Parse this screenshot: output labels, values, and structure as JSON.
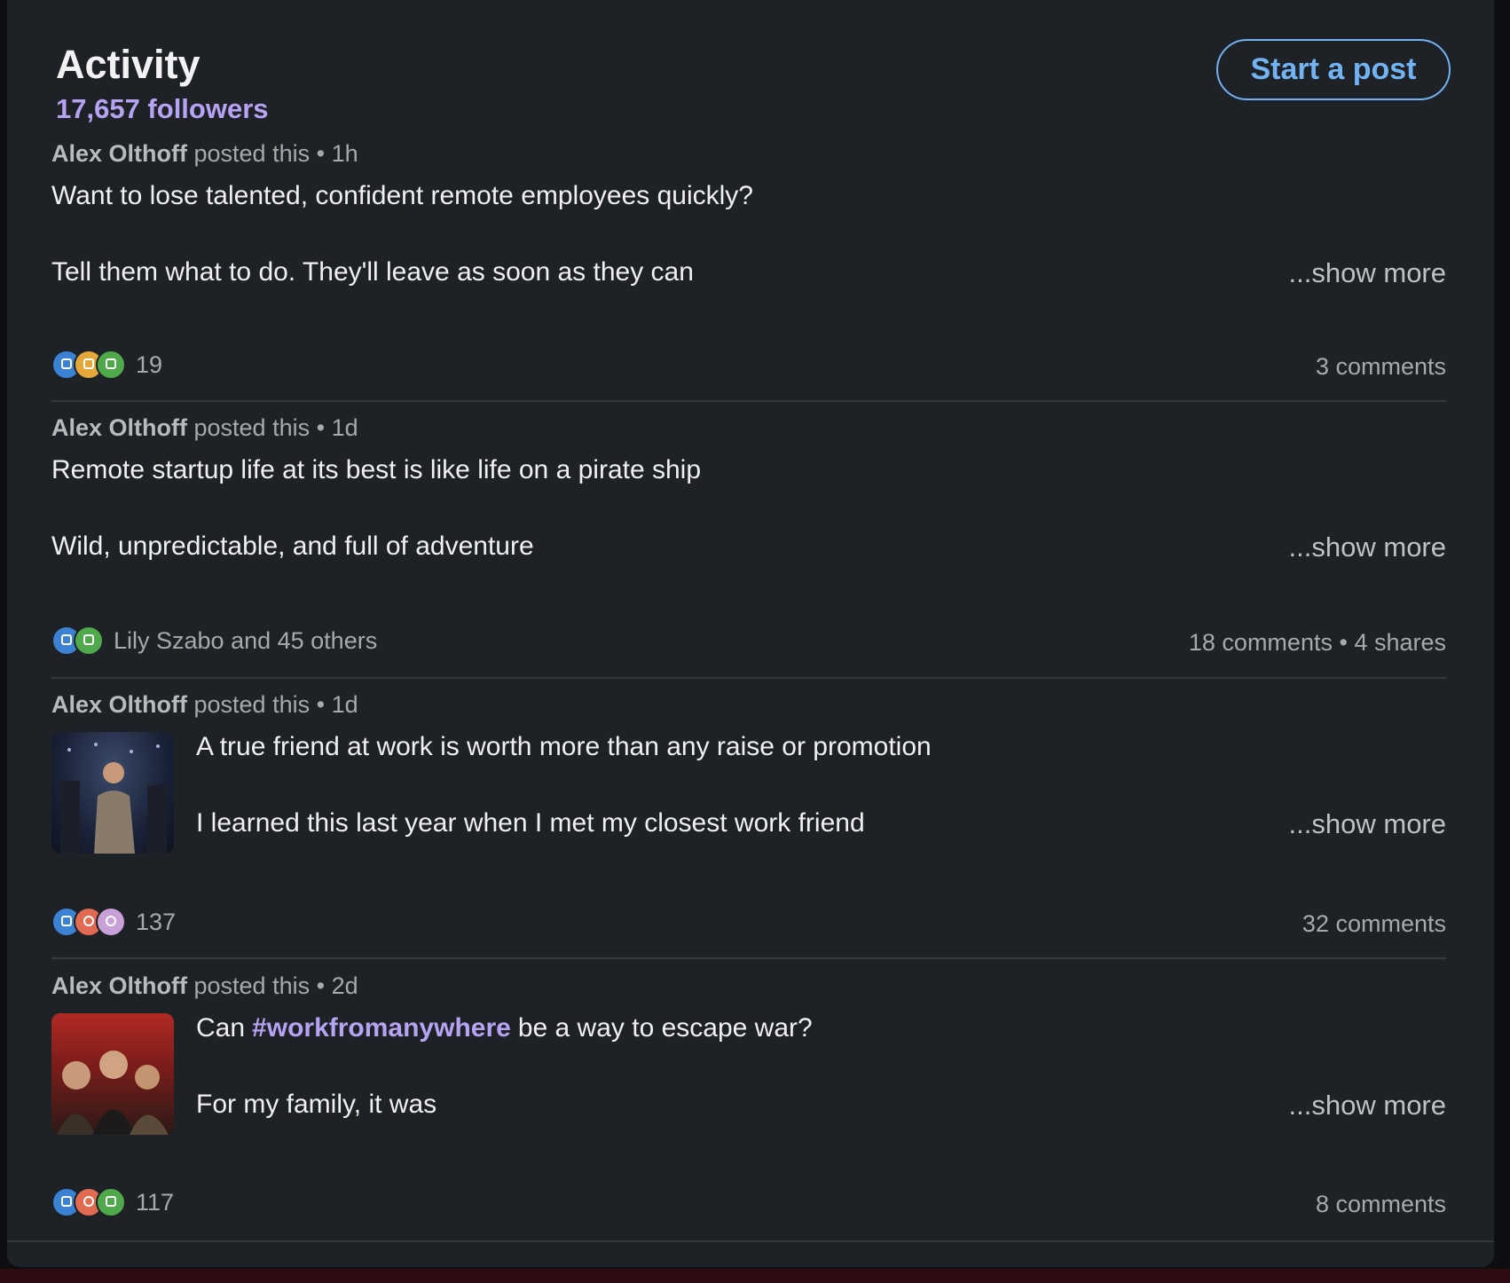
{
  "activity": {
    "title": "Activity",
    "followers": "17,657 followers",
    "start_post_label": "Start a post"
  },
  "posts": [
    {
      "author": "Alex Olthoff",
      "action": " posted this",
      "time": "1h",
      "line1": "Want to lose talented, confident remote employees quickly?",
      "line2": "Tell them what to do. They'll leave as soon as they can",
      "show_more": "...show more",
      "reactions": [
        "like",
        "insightful",
        "celebrate"
      ],
      "reaction_count": "19",
      "comments": "3 comments"
    },
    {
      "author": "Alex Olthoff",
      "action": " posted this",
      "time": "1d",
      "line1": "Remote startup life at its best is like life on a pirate ship",
      "line2": "Wild, unpredictable, and full of adventure",
      "show_more": "...show more",
      "reactions": [
        "like",
        "celebrate"
      ],
      "reaction_count": "Lily Szabo and 45 others",
      "comments": "18 comments",
      "shares": "4 shares"
    },
    {
      "author": "Alex Olthoff",
      "action": " posted this",
      "time": "1d",
      "line1": "A true friend at work is worth more than any raise or promotion",
      "line2": "I learned this last year when I met my closest work friend",
      "show_more": "...show more",
      "reactions": [
        "like",
        "love",
        "support"
      ],
      "reaction_count": "137",
      "comments": "32 comments"
    },
    {
      "author": "Alex Olthoff",
      "action": " posted this",
      "time": "2d",
      "line1_pre": "Can",
      "hashtag": "#workfromanywhere",
      "line1_post": "be a way to escape war?",
      "line2": "For my family, it was",
      "show_more": "...show more",
      "reactions": [
        "like",
        "love",
        "celebrate"
      ],
      "reaction_count": "117",
      "comments": "8 comments"
    }
  ],
  "separator": " • ",
  "colors": {
    "card_bg": "#1e2126",
    "accent_blue": "#72b3f3",
    "accent_purple": "#b7a3f3",
    "muted_text": "#a7a9ad"
  }
}
